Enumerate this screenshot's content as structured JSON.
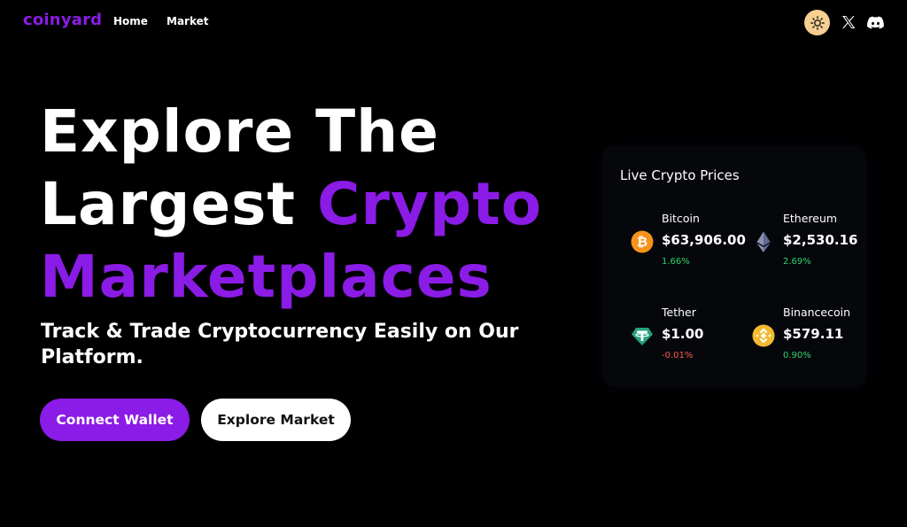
{
  "header": {
    "logo": "coinyard",
    "nav": [
      {
        "label": "Home"
      },
      {
        "label": "Market"
      }
    ],
    "icons": {
      "theme": "sun-icon",
      "twitter": "x-icon",
      "discord": "discord-icon"
    }
  },
  "hero": {
    "title_line1": "Explore The",
    "title_line2_plain": "Largest",
    "title_line2_accent": "Crypto",
    "title_line3_accent": "Marketplaces",
    "subtitle": "Track & Trade Cryptocurrency Easily on Our Platform.",
    "primary_button": "Connect Wallet",
    "secondary_button": "Explore Market"
  },
  "prices": {
    "title": "Live Crypto Prices",
    "coins": [
      {
        "name": "Bitcoin",
        "price": "$63,906.00",
        "change": "1.66%",
        "icon": "bitcoin-icon",
        "trend": "up"
      },
      {
        "name": "Ethereum",
        "price": "$2,530.16",
        "change": "2.69%",
        "icon": "ethereum-icon",
        "trend": "up"
      },
      {
        "name": "Tether",
        "price": "$1.00",
        "change": "-0.01%",
        "icon": "tether-icon",
        "trend": "down"
      },
      {
        "name": "Binancecoin",
        "price": "$579.11",
        "change": "0.90%",
        "icon": "binance-icon",
        "trend": "up"
      }
    ]
  },
  "colors": {
    "accent": "#8b1be6",
    "background": "#000000",
    "positive": "#2fd36a",
    "negative": "#ff5a4e",
    "theme_toggle": "#f6cf92",
    "bitcoin": "#f7931a",
    "tether": "#26a17b",
    "binance": "#f3ba2f"
  }
}
